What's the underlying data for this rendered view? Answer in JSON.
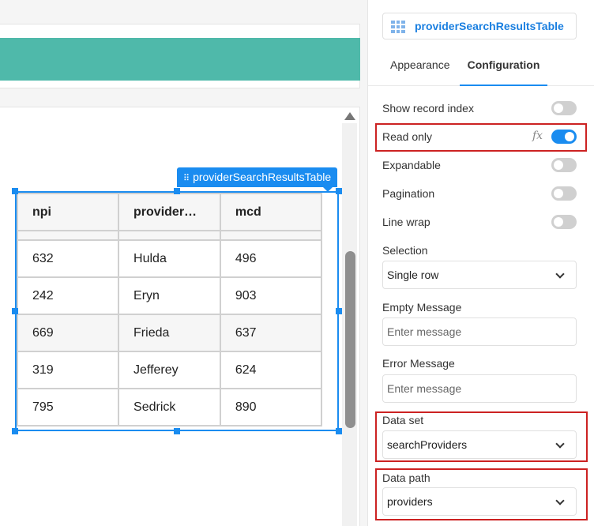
{
  "canvas": {
    "component_tag": "providerSearchResultsTable",
    "table": {
      "columns": [
        "npi",
        "provider…",
        "mcd"
      ],
      "rows": [
        [
          "632",
          "Hulda",
          "496"
        ],
        [
          "242",
          "Eryn",
          "903"
        ],
        [
          "669",
          "Frieda",
          "637"
        ],
        [
          "319",
          "Jefferey",
          "624"
        ],
        [
          "795",
          "Sedrick",
          "890"
        ]
      ]
    },
    "colors": {
      "teal_bar": "#4fb9aa",
      "selection": "#1a8cf0"
    }
  },
  "panel": {
    "component_name": "providerSearchResultsTable",
    "tabs": [
      {
        "label": "Appearance",
        "active": false
      },
      {
        "label": "Configuration",
        "active": true
      }
    ],
    "toggles": {
      "show_record_index": {
        "label": "Show record index",
        "on": false
      },
      "read_only": {
        "label": "Read only",
        "on": true,
        "fx": "fx"
      },
      "expandable": {
        "label": "Expandable",
        "on": false
      },
      "pagination": {
        "label": "Pagination",
        "on": false
      },
      "line_wrap": {
        "label": "Line wrap",
        "on": false
      }
    },
    "selection": {
      "label": "Selection",
      "value": "Single row"
    },
    "empty_message": {
      "label": "Empty Message",
      "placeholder": "Enter message"
    },
    "error_message": {
      "label": "Error Message",
      "placeholder": "Enter message"
    },
    "data_set": {
      "label": "Data set",
      "value": "searchProviders"
    },
    "data_path": {
      "label": "Data path",
      "value": "providers"
    },
    "colors": {
      "accent": "#1a8cf0",
      "highlight": "#cc2222"
    }
  }
}
